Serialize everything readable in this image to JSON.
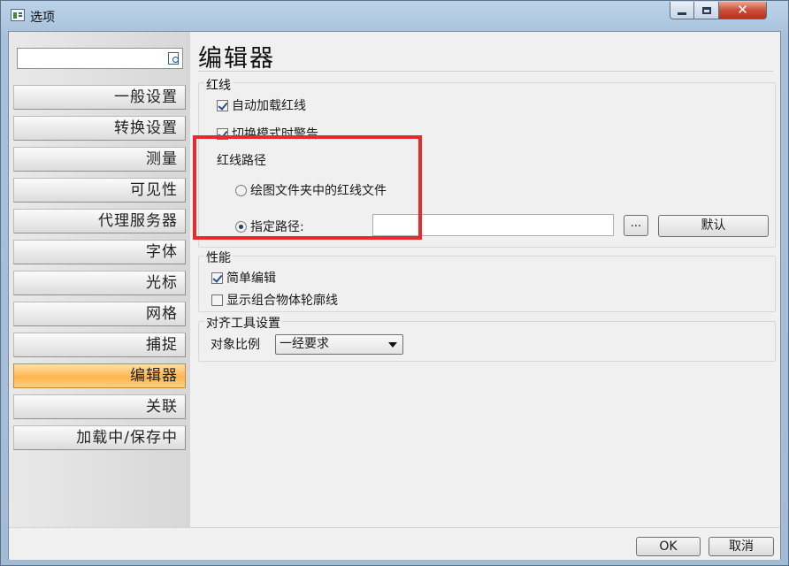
{
  "window": {
    "title": "选项"
  },
  "search": {
    "value": "",
    "placeholder": ""
  },
  "sidebar": {
    "items": [
      {
        "label": "一般设置"
      },
      {
        "label": "转换设置"
      },
      {
        "label": "测量"
      },
      {
        "label": "可见性"
      },
      {
        "label": "代理服务器"
      },
      {
        "label": "字体"
      },
      {
        "label": "光标"
      },
      {
        "label": "网格"
      },
      {
        "label": "捕捉"
      },
      {
        "label": "编辑器",
        "active": true
      },
      {
        "label": "关联"
      },
      {
        "label": "加载中/保存中"
      }
    ]
  },
  "main": {
    "title": "编辑器",
    "redline": {
      "group_label": "红线",
      "auto_load": {
        "label": "自动加载红线",
        "checked": true
      },
      "warn_on_switch": {
        "label": "切换模式时警告",
        "checked": true
      },
      "path_label": "红线路径",
      "option_drawing_folder": {
        "label": "绘图文件夹中的红线文件",
        "selected": false
      },
      "option_specified_path": {
        "label": "指定路径:",
        "selected": true
      },
      "path_value": "",
      "browse_label": "...",
      "default_label": "默认"
    },
    "performance": {
      "group_label": "性能",
      "simple_edit": {
        "label": "简单编辑",
        "checked": true
      },
      "show_outline": {
        "label": "显示组合物体轮廓线",
        "checked": false
      }
    },
    "align": {
      "group_label": "对齐工具设置",
      "scale_label": "对象比例",
      "scale_value": "一经要求"
    }
  },
  "footer": {
    "ok_label": "OK",
    "cancel_label": "取消"
  },
  "colors": {
    "highlight": "#e9292a",
    "active_nav": "#ffb54f"
  }
}
